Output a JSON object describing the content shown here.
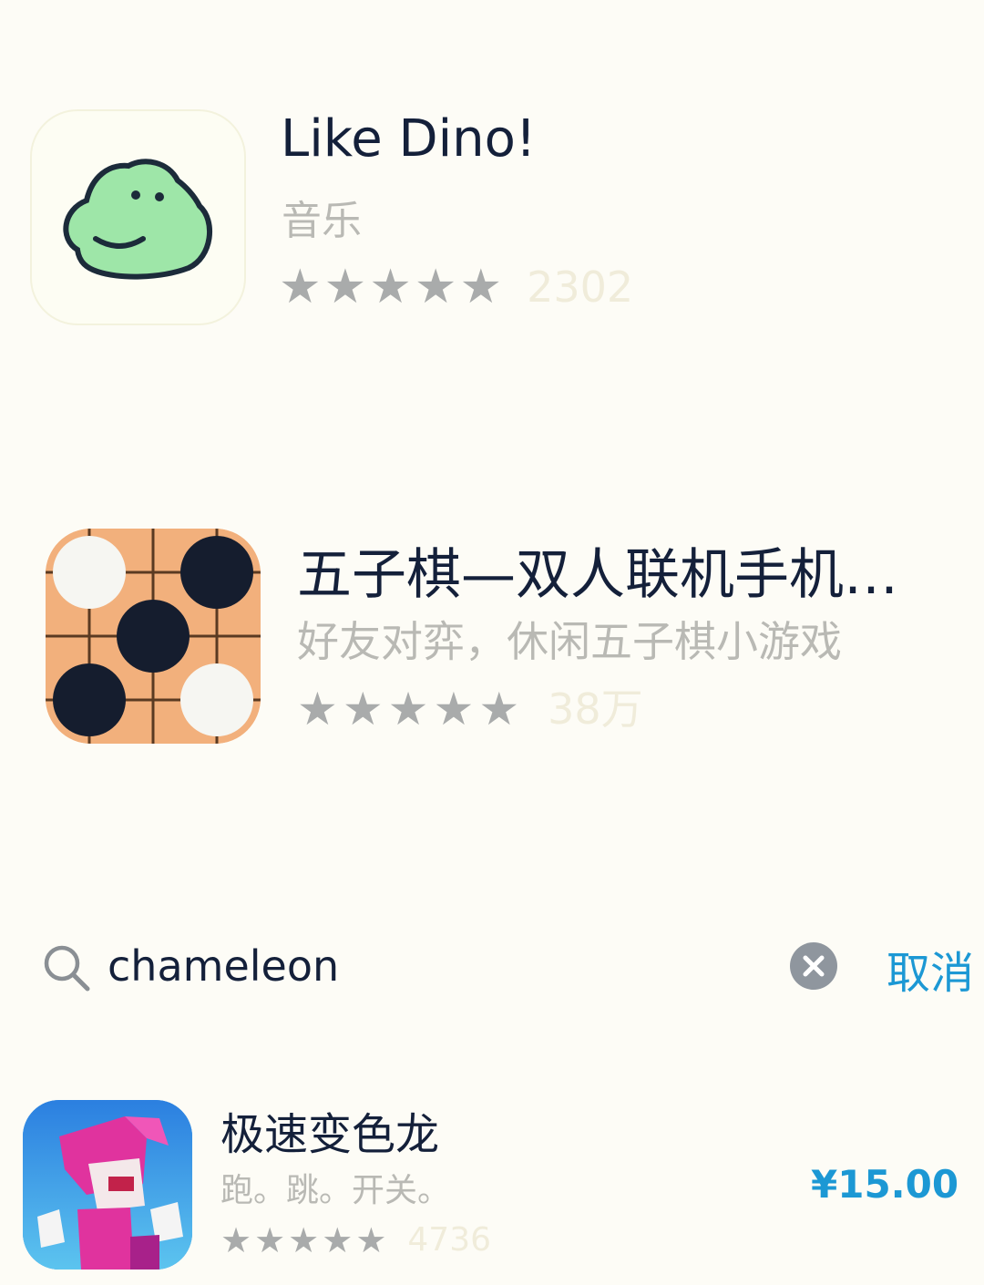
{
  "apps": [
    {
      "title": "Like Dino!",
      "subtitle": "音乐",
      "rating_stars": 5,
      "rating_count": "2302",
      "icon": "dino-face-icon"
    },
    {
      "title": "五子棋—双人联机手机…",
      "subtitle": "好友对弈，休闲五子棋小游戏",
      "rating_stars": 4.5,
      "rating_count": "38万",
      "icon": "gomoku-board-icon"
    }
  ],
  "search": {
    "query": "chameleon",
    "cancel_label": "取消",
    "icon": "search-icon",
    "clear_icon": "clear-icon"
  },
  "results": [
    {
      "title": "极速变色龙",
      "subtitle": "跑。跳。开关。",
      "rating_stars": 4.5,
      "rating_count": "4736",
      "price": "¥15.00",
      "icon": "chameleon-run-icon"
    }
  ],
  "colors": {
    "accent": "#1c98d4",
    "title_text": "#14203a",
    "subtitle_text": "#b9b9b4",
    "star": "#a9abab",
    "background": "#fdfcf6"
  }
}
